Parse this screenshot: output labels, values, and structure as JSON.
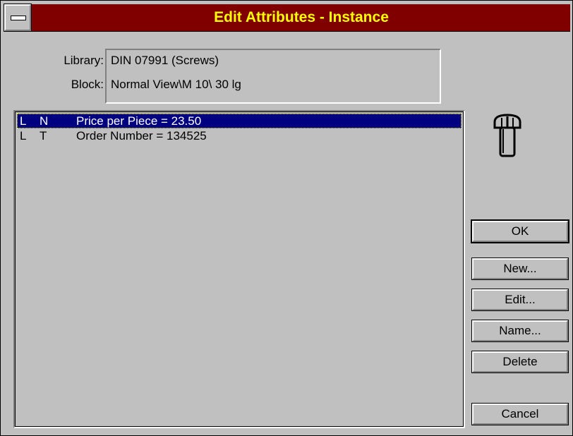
{
  "window": {
    "title": "Edit Attributes - Instance",
    "title_color": "#ffff00",
    "titlebar_color": "#800000"
  },
  "info": {
    "library_label": "Library:",
    "library_value": "DIN 07991 (Screws)",
    "block_label": "Block:",
    "block_value": "Normal View\\M 10\\ 30 lg"
  },
  "attributes": [
    {
      "flag1": "L",
      "flag2": "N",
      "text": "Price per Piece = 23.50",
      "selected": true
    },
    {
      "flag1": "L",
      "flag2": "T",
      "text": "Order Number = 134525",
      "selected": false
    }
  ],
  "buttons": {
    "ok": "OK",
    "new": "New...",
    "edit": "Edit...",
    "name": "Name...",
    "delete": "Delete",
    "cancel": "Cancel"
  },
  "icons": {
    "system_menu": "system-menu-icon",
    "block_preview": "bolt-icon"
  },
  "colors": {
    "selection": "#000080",
    "face": "#c0c0c0"
  }
}
